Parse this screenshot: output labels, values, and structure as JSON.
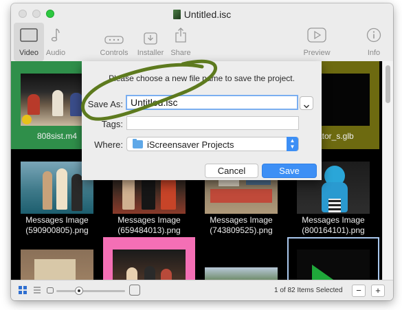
{
  "window": {
    "title": "Untitled.isc"
  },
  "toolbar": {
    "items": [
      {
        "label": "Video",
        "icon": "video-frame-icon"
      },
      {
        "label": "Audio",
        "icon": "music-note-icon"
      },
      {
        "label": "Controls",
        "icon": "controls-icon"
      },
      {
        "label": "Installer",
        "icon": "installer-icon"
      },
      {
        "label": "Share",
        "icon": "share-icon"
      },
      {
        "label": "Preview",
        "icon": "play-icon"
      },
      {
        "label": "Info",
        "icon": "info-icon"
      }
    ]
  },
  "grid": {
    "items": [
      {
        "label_1": "808sist.m4",
        "label_2": ""
      },
      {
        "label_1": "",
        "label_2": ""
      },
      {
        "label_1": "",
        "label_2": ""
      },
      {
        "label_1": "dator_s.glb",
        "label_2": ""
      },
      {
        "label_1": "Messages Image",
        "label_2": "(590900805).png"
      },
      {
        "label_1": "Messages Image",
        "label_2": "(659484013).png"
      },
      {
        "label_1": "Messages Image",
        "label_2": "(743809525).png"
      },
      {
        "label_1": "Messages Image",
        "label_2": "(800164101).png"
      }
    ]
  },
  "dialog": {
    "prompt": "Please choose a new file name to save the project.",
    "save_as_label": "Save As:",
    "save_as_value": "Untitled.isc",
    "tags_label": "Tags:",
    "tags_value": "",
    "where_label": "Where:",
    "where_value": "iScreensaver Projects",
    "cancel_label": "Cancel",
    "save_label": "Save"
  },
  "bottom_bar": {
    "status": "1 of 82 Items Selected",
    "minus_label": "−",
    "plus_label": "+",
    "zoom_level": 0.33
  },
  "colors": {
    "accent": "#3d8ff5",
    "highlight_oval": "#5d7a1e",
    "grid_background": "#000000",
    "cell_green": "#2f8f4a",
    "cell_olive": "#6d6a10",
    "cell_pink": "#f46fb5",
    "cell_selected_border": "#a9c8ee"
  }
}
